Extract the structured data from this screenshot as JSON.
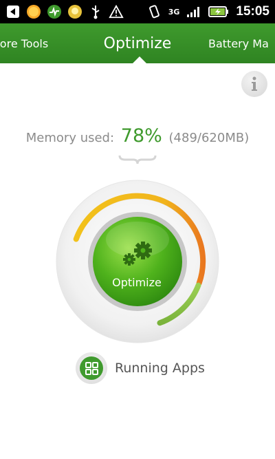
{
  "status_bar": {
    "time": "15:05",
    "network_type": "3G",
    "icons": [
      "back-icon",
      "sun-icon",
      "activity-chat-icon",
      "bulb-icon",
      "usb-icon",
      "warning-icon",
      "vibrate-icon",
      "signal-icon",
      "battery-charging-icon"
    ]
  },
  "tabs": [
    {
      "label": "More Tools"
    },
    {
      "label": "Optimize",
      "active": true
    },
    {
      "label": "Battery Ma"
    }
  ],
  "memory": {
    "prefix": "Memory used:",
    "percent": "78%",
    "detail": "(489/620MB)",
    "level": 0.78
  },
  "optimize": {
    "label": "Optimize"
  },
  "running_apps": {
    "label": "Running Apps"
  },
  "colors": {
    "brand_green": "#3f9a2d",
    "gauge_yellow": "#f2c21b",
    "gauge_orange": "#e9771f",
    "gauge_light_green": "#8cc63f"
  }
}
